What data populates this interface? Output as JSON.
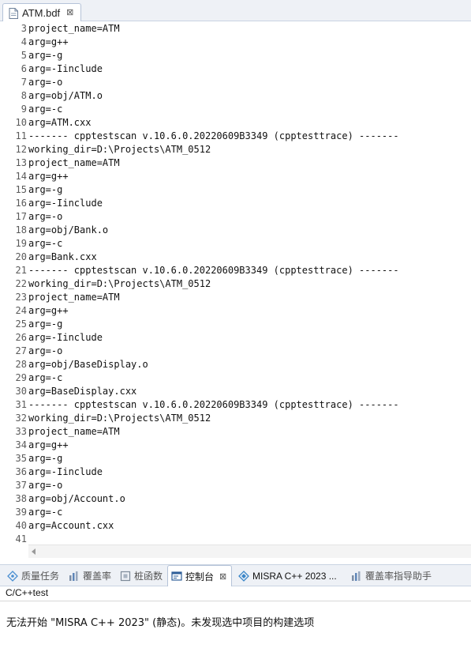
{
  "editor_tab": {
    "title": "ATM.bdf",
    "close": "⊠"
  },
  "editor": {
    "lines": [
      {
        "n": "3",
        "text": "project_name=ATM"
      },
      {
        "n": "4",
        "text": "arg=g++"
      },
      {
        "n": "5",
        "text": "arg=-g"
      },
      {
        "n": "6",
        "text": "arg=-Iinclude"
      },
      {
        "n": "7",
        "text": "arg=-o"
      },
      {
        "n": "8",
        "text": "arg=obj/ATM.o"
      },
      {
        "n": "9",
        "text": "arg=-c"
      },
      {
        "n": "10",
        "text": "arg=ATM.cxx"
      },
      {
        "n": "11",
        "text": "------- cpptestscan v.10.6.0.20220609B3349 (cpptesttrace) -------"
      },
      {
        "n": "12",
        "text": "working_dir=D:\\Projects\\ATM_0512"
      },
      {
        "n": "13",
        "text": "project_name=ATM"
      },
      {
        "n": "14",
        "text": "arg=g++"
      },
      {
        "n": "15",
        "text": "arg=-g"
      },
      {
        "n": "16",
        "text": "arg=-Iinclude"
      },
      {
        "n": "17",
        "text": "arg=-o"
      },
      {
        "n": "18",
        "text": "arg=obj/Bank.o"
      },
      {
        "n": "19",
        "text": "arg=-c"
      },
      {
        "n": "20",
        "text": "arg=Bank.cxx"
      },
      {
        "n": "21",
        "text": "------- cpptestscan v.10.6.0.20220609B3349 (cpptesttrace) -------"
      },
      {
        "n": "22",
        "text": "working_dir=D:\\Projects\\ATM_0512"
      },
      {
        "n": "23",
        "text": "project_name=ATM"
      },
      {
        "n": "24",
        "text": "arg=g++"
      },
      {
        "n": "25",
        "text": "arg=-g"
      },
      {
        "n": "26",
        "text": "arg=-Iinclude"
      },
      {
        "n": "27",
        "text": "arg=-o"
      },
      {
        "n": "28",
        "text": "arg=obj/BaseDisplay.o"
      },
      {
        "n": "29",
        "text": "arg=-c"
      },
      {
        "n": "30",
        "text": "arg=BaseDisplay.cxx"
      },
      {
        "n": "31",
        "text": "------- cpptestscan v.10.6.0.20220609B3349 (cpptesttrace) -------"
      },
      {
        "n": "32",
        "text": "working_dir=D:\\Projects\\ATM_0512"
      },
      {
        "n": "33",
        "text": "project_name=ATM"
      },
      {
        "n": "34",
        "text": "arg=g++"
      },
      {
        "n": "35",
        "text": "arg=-g"
      },
      {
        "n": "36",
        "text": "arg=-Iinclude"
      },
      {
        "n": "37",
        "text": "arg=-o"
      },
      {
        "n": "38",
        "text": "arg=obj/Account.o"
      },
      {
        "n": "39",
        "text": "arg=-c"
      },
      {
        "n": "40",
        "text": "arg=Account.cxx"
      },
      {
        "n": "41",
        "text": ""
      }
    ]
  },
  "view_tabs": {
    "quality_tasks": "质量任务",
    "coverage": "覆盖率",
    "stub_functions": "桩函数",
    "console": "控制台",
    "console_close": "⊠",
    "misra": "MISRA C++ 2023 ...",
    "coverage_advisor": "覆盖率指导助手"
  },
  "console": {
    "title": "C/C++test",
    "message": "无法开始 \"MISRA C++ 2023\" (静态)。未发现选中项目的构建选项"
  },
  "colors": {
    "accent": "#2f6fb6",
    "tab_bar_bg": "#eef1f6",
    "border": "#b5c3d8"
  }
}
